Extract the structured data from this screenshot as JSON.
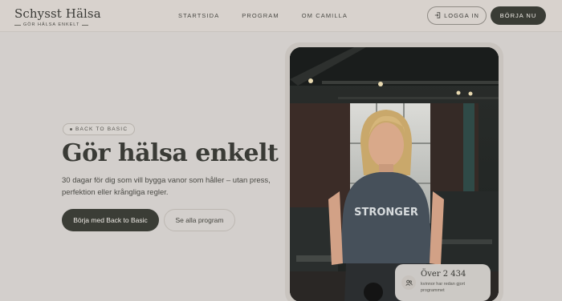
{
  "header": {
    "logo_name": "Schysst Hälsa",
    "logo_tagline": "GÖR HÄLSA ENKELT",
    "nav": [
      {
        "label": "STARTSIDA"
      },
      {
        "label": "PROGRAM"
      },
      {
        "label": "OM CAMILLA"
      }
    ],
    "login_label": "LOGGA IN",
    "login_icon": "login-icon",
    "start_label": "BÖRJA NU"
  },
  "hero": {
    "badge": "BACK TO BASIC",
    "title": "Gör hälsa enkelt",
    "subtitle": "30 dagar för dig som vill bygga vanor som håller – utan press, perfektion eller krångliga regler.",
    "primary_cta": "Börja med Back to Basic",
    "secondary_cta": "Se alla program"
  },
  "stat": {
    "icon": "users-icon",
    "value": "Över 2 434",
    "caption": "kvinnor har redan gjort programmet"
  },
  "photo": {
    "shirt_text": "STRONGER",
    "subject": "woman-in-gym-photo"
  },
  "colors": {
    "background": "#d3cfcc",
    "dark_button": "#3a3c35",
    "text": "#3a3b36"
  }
}
